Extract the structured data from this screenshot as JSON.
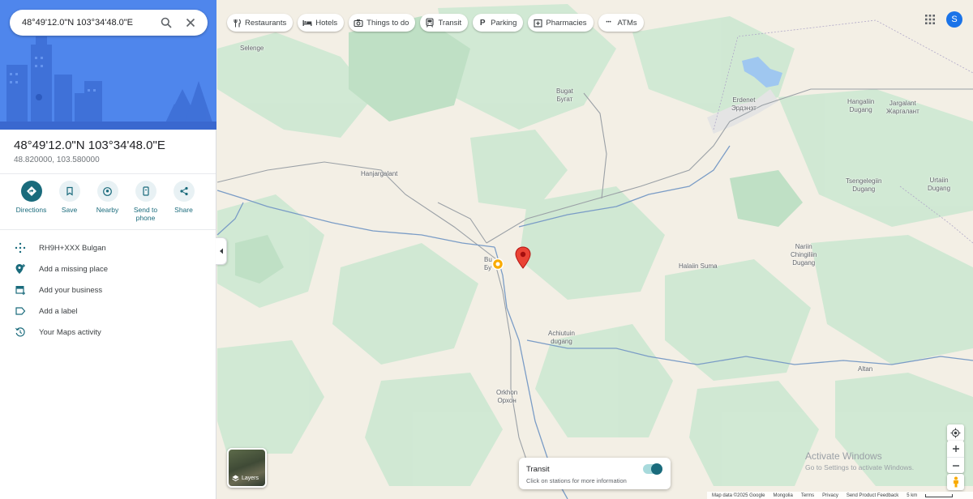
{
  "search": {
    "value": "48°49'12.0\"N 103°34'48.0\"E"
  },
  "place": {
    "title": "48°49'12.0\"N 103°34'48.0\"E",
    "decimal": "48.820000, 103.580000"
  },
  "actions": [
    {
      "label": "Directions",
      "icon": "directions-icon"
    },
    {
      "label": "Save",
      "icon": "bookmark-icon"
    },
    {
      "label": "Nearby",
      "icon": "nearby-icon"
    },
    {
      "label": "Send to phone",
      "icon": "phone-icon"
    },
    {
      "label": "Share",
      "icon": "share-icon"
    }
  ],
  "details": [
    {
      "text": "RH9H+XXX Bulgan",
      "icon": "plus-code-icon"
    },
    {
      "text": "Add a missing place",
      "icon": "add-place-icon"
    },
    {
      "text": "Add your business",
      "icon": "store-icon"
    },
    {
      "text": "Add a label",
      "icon": "label-icon"
    },
    {
      "text": "Your Maps activity",
      "icon": "history-icon"
    }
  ],
  "chips": [
    {
      "label": "Restaurants",
      "icon": "restaurant-icon"
    },
    {
      "label": "Hotels",
      "icon": "hotel-icon"
    },
    {
      "label": "Things to do",
      "icon": "camera-icon"
    },
    {
      "label": "Transit",
      "icon": "transit-icon"
    },
    {
      "label": "Parking",
      "icon": "parking-icon"
    },
    {
      "label": "Pharmacies",
      "icon": "pharmacy-icon"
    },
    {
      "label": "ATMs",
      "icon": "atm-icon"
    }
  ],
  "account": {
    "initial": "S"
  },
  "map_labels": {
    "selenge": "Selenge",
    "bugat": "Bugat\nБугат",
    "erdenet": "Erdenet\nЭрдэнэт",
    "hangaliin": "Hangaliin\nDugang",
    "jargalant": "Jargalant\nЖаргалант",
    "hanjargalant": "Hanjargalant",
    "tsengegiin": "Tsengelegiin\nDugang",
    "urtaiin": "Urtaiin\nDugang",
    "bulgan": "Bu\nБу",
    "halaiin": "Halaiin Suma",
    "nariin": "Nariin\nChingiliin\nDugang",
    "achiutuin": "Achiutuin\ndugang",
    "orkhon": "Orkhon\nОрхон",
    "altan": "Altan"
  },
  "layers": {
    "label": "Layers"
  },
  "transit_card": {
    "title": "Transit",
    "subtitle": "Click on stations for more information",
    "enabled": true
  },
  "watermark": {
    "line1": "Activate Windows",
    "line2": "Go to Settings to activate Windows."
  },
  "footer": {
    "map_data": "Map data ©2025 Google",
    "country": "Mongolia",
    "terms": "Terms",
    "privacy": "Privacy",
    "feedback": "Send Product Feedback",
    "scale": "5 km"
  },
  "colors": {
    "accent": "#1a6b7c",
    "hero": "#4f86ec",
    "pin": "#ea4335",
    "river": "#7a9cc6",
    "forest": "#c9e7cf"
  }
}
